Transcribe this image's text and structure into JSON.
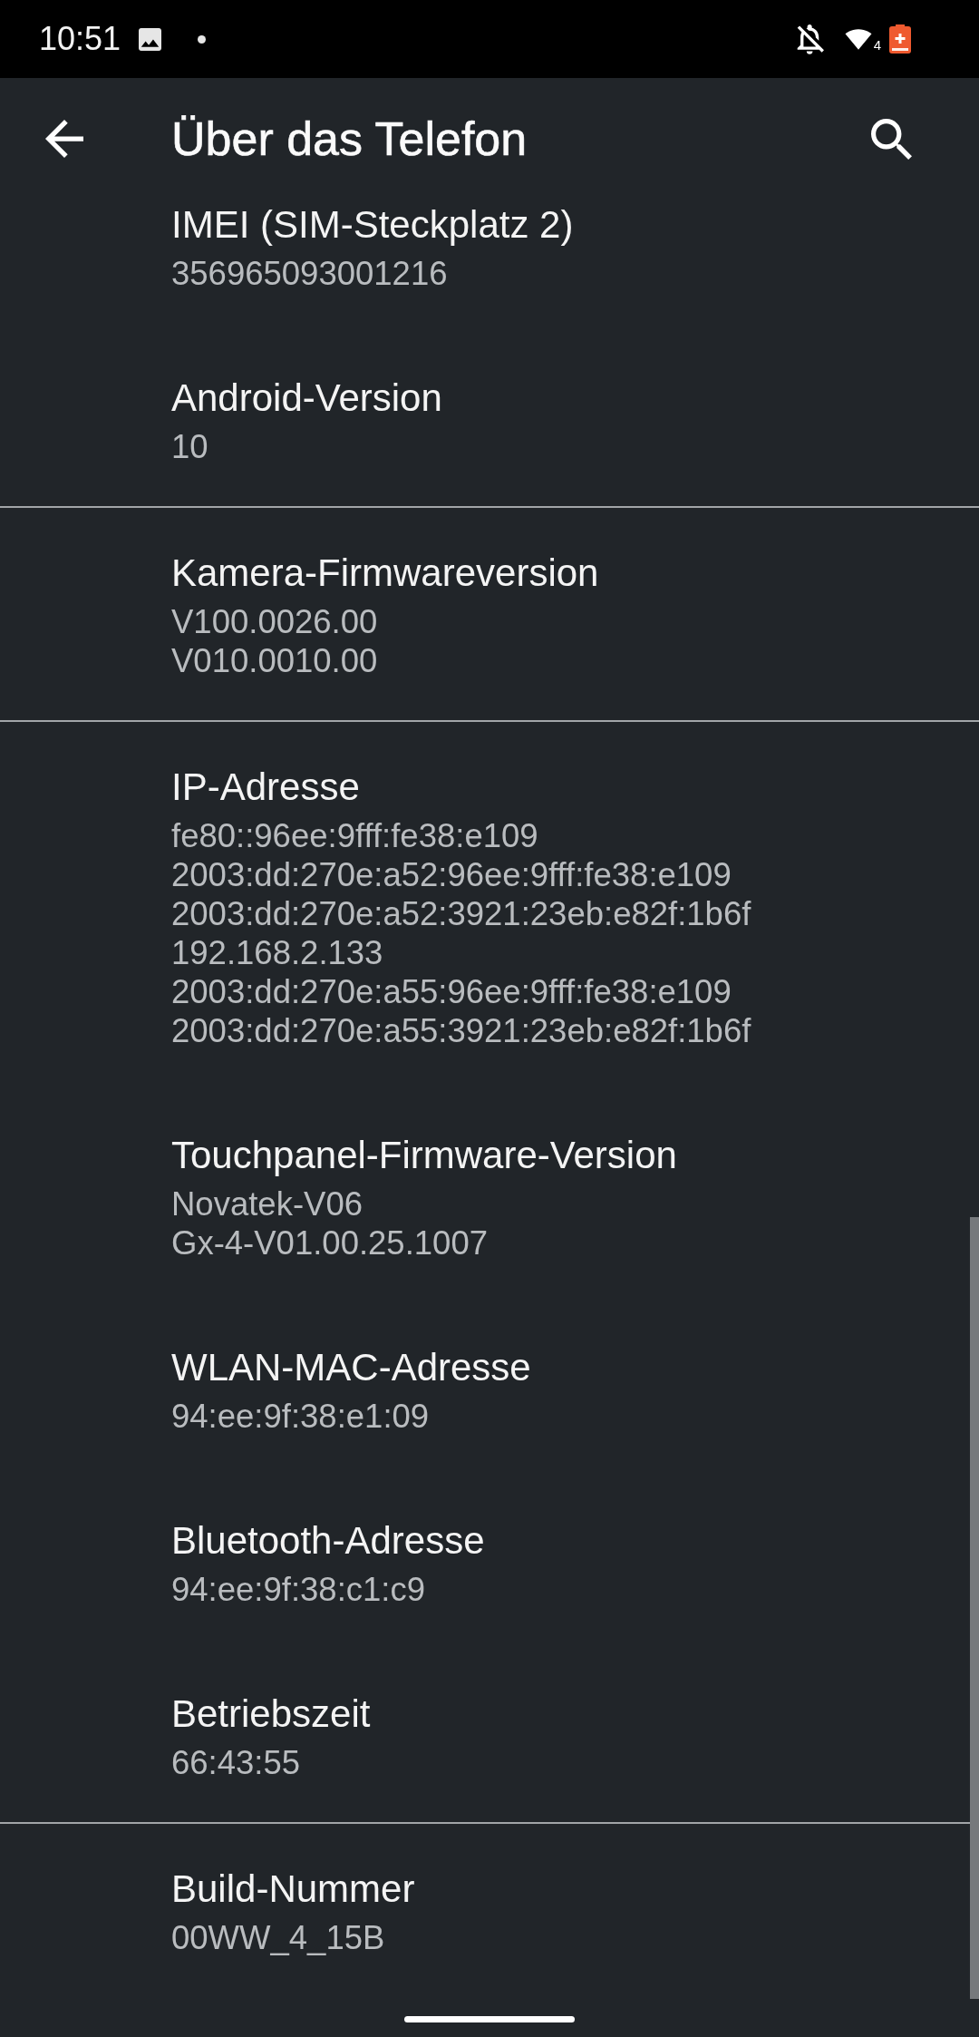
{
  "status_bar": {
    "time": "10:51",
    "wifi_label": "4"
  },
  "app_bar": {
    "title": "Über das Telefon"
  },
  "sections": [
    {
      "items": [
        {
          "title": "IMEI (SIM-Steckplatz 2)",
          "values": [
            "356965093001216"
          ]
        },
        {
          "title": "Android-Version",
          "values": [
            "10"
          ]
        }
      ]
    },
    {
      "items": [
        {
          "title": "Kamera-Firmwareversion",
          "values": [
            "V100.0026.00",
            "V010.0010.00"
          ]
        }
      ]
    },
    {
      "items": [
        {
          "title": "IP-Adresse",
          "values": [
            "fe80::96ee:9fff:fe38:e109",
            "2003:dd:270e:a52:96ee:9fff:fe38:e109",
            "2003:dd:270e:a52:3921:23eb:e82f:1b6f",
            "192.168.2.133",
            "2003:dd:270e:a55:96ee:9fff:fe38:e109",
            "2003:dd:270e:a55:3921:23eb:e82f:1b6f"
          ]
        },
        {
          "title": "Touchpanel-Firmware-Version",
          "values": [
            "Novatek-V06",
            "Gx-4-V01.00.25.1007"
          ]
        },
        {
          "title": "WLAN-MAC-Adresse",
          "values": [
            "94:ee:9f:38:e1:09"
          ]
        },
        {
          "title": "Bluetooth-Adresse",
          "values": [
            "94:ee:9f:38:c1:c9"
          ]
        },
        {
          "title": "Betriebszeit",
          "values": [
            "66:43:55"
          ]
        }
      ]
    },
    {
      "items": [
        {
          "title": "Build-Nummer",
          "values": [
            "00WW_4_15B"
          ]
        }
      ]
    }
  ]
}
